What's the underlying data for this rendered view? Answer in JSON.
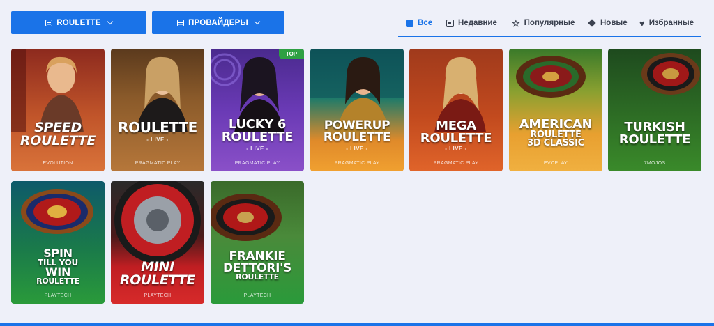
{
  "filters": {
    "category_label": "ROULETTE",
    "providers_label": "ПРОВАЙДЕРЫ"
  },
  "tabs": [
    {
      "label": "Все",
      "icon": "list-icon",
      "active": true
    },
    {
      "label": "Недавние",
      "icon": "recent-icon",
      "active": false
    },
    {
      "label": "Популярные",
      "icon": "star-icon",
      "active": false
    },
    {
      "label": "Новые",
      "icon": "diamond-icon",
      "active": false
    },
    {
      "label": "Избранные",
      "icon": "heart-icon",
      "active": false
    }
  ],
  "games": [
    {
      "title1": "SPEED",
      "title2": "ROULETTE",
      "sub": "",
      "provider": "EVOLUTION",
      "badge": ""
    },
    {
      "title1": "ROULETTE",
      "title2": "",
      "sub": "- LIVE -",
      "provider": "PRAGMATIC PLAY",
      "badge": ""
    },
    {
      "title1": "LUCKY 6",
      "title2": "ROULETTE",
      "sub": "- LIVE -",
      "provider": "PRAGMATIC PLAY",
      "badge": "TOP"
    },
    {
      "title1": "POWERUP",
      "title2": "ROULETTE",
      "sub": "- LIVE -",
      "provider": "PRAGMATIC PLAY",
      "badge": ""
    },
    {
      "title1": "MEGA",
      "title2": "ROULETTE",
      "sub": "- LIVE -",
      "provider": "PRAGMATIC PLAY",
      "badge": ""
    },
    {
      "title1": "AMERICAN",
      "title2": "ROULETTE",
      "title3": "3D CLASSIC",
      "sub": "",
      "provider": "EVOPLAY",
      "badge": ""
    },
    {
      "title1": "TURKISH",
      "title2": "ROULETTE",
      "sub": "",
      "provider": "7MOJOS",
      "badge": ""
    },
    {
      "title1": "SPIN",
      "title2": "TILL YOU",
      "title3": "WIN",
      "title4": "ROULETTE",
      "sub": "",
      "provider": "PLAYTECH",
      "badge": ""
    },
    {
      "title1": "MINI",
      "title2": "ROULETTE",
      "sub": "",
      "provider": "PLAYTECH",
      "badge": ""
    },
    {
      "title1": "FRANKIE",
      "title2": "DETTORI'S",
      "title3": "ROULETTE",
      "sub": "",
      "provider": "PLAYTECH",
      "badge": ""
    }
  ],
  "colors": {
    "accent": "#1a73e8",
    "background": "#eef0f9",
    "top_badge": "#2ea043"
  }
}
